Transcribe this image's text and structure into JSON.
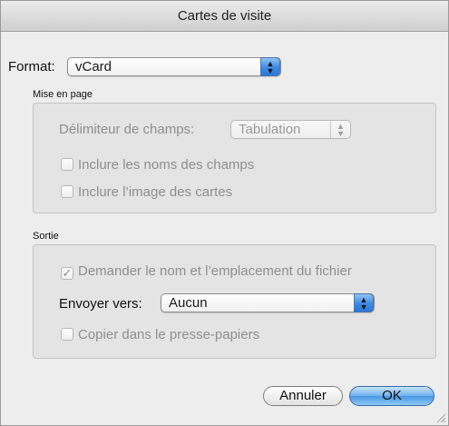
{
  "window": {
    "title": "Cartes de visite"
  },
  "format": {
    "label": "Format:",
    "value": "vCard"
  },
  "layout": {
    "title": "Mise en page",
    "delimiter_label": "Délimiteur de champs:",
    "delimiter_value": "Tabulation",
    "include_field_names": {
      "label": "Inclure les noms des champs",
      "checked": false
    },
    "include_card_image": {
      "label": "Inclure l’image des cartes",
      "checked": false
    }
  },
  "output": {
    "title": "Sortie",
    "ask_name": {
      "label": "Demander le nom et l’emplacement du fichier",
      "checked": true
    },
    "send_to_label": "Envoyer vers:",
    "send_to_value": "Aucun",
    "copy_clipboard": {
      "label": "Copier dans le presse-papiers",
      "checked": false
    }
  },
  "buttons": {
    "cancel": "Annuler",
    "ok": "OK"
  },
  "colors": {
    "accent": "#4a97e3",
    "window_bg": "#ededed",
    "group_bg": "#e4e4e4",
    "disabled_text": "#8f8f8f"
  }
}
